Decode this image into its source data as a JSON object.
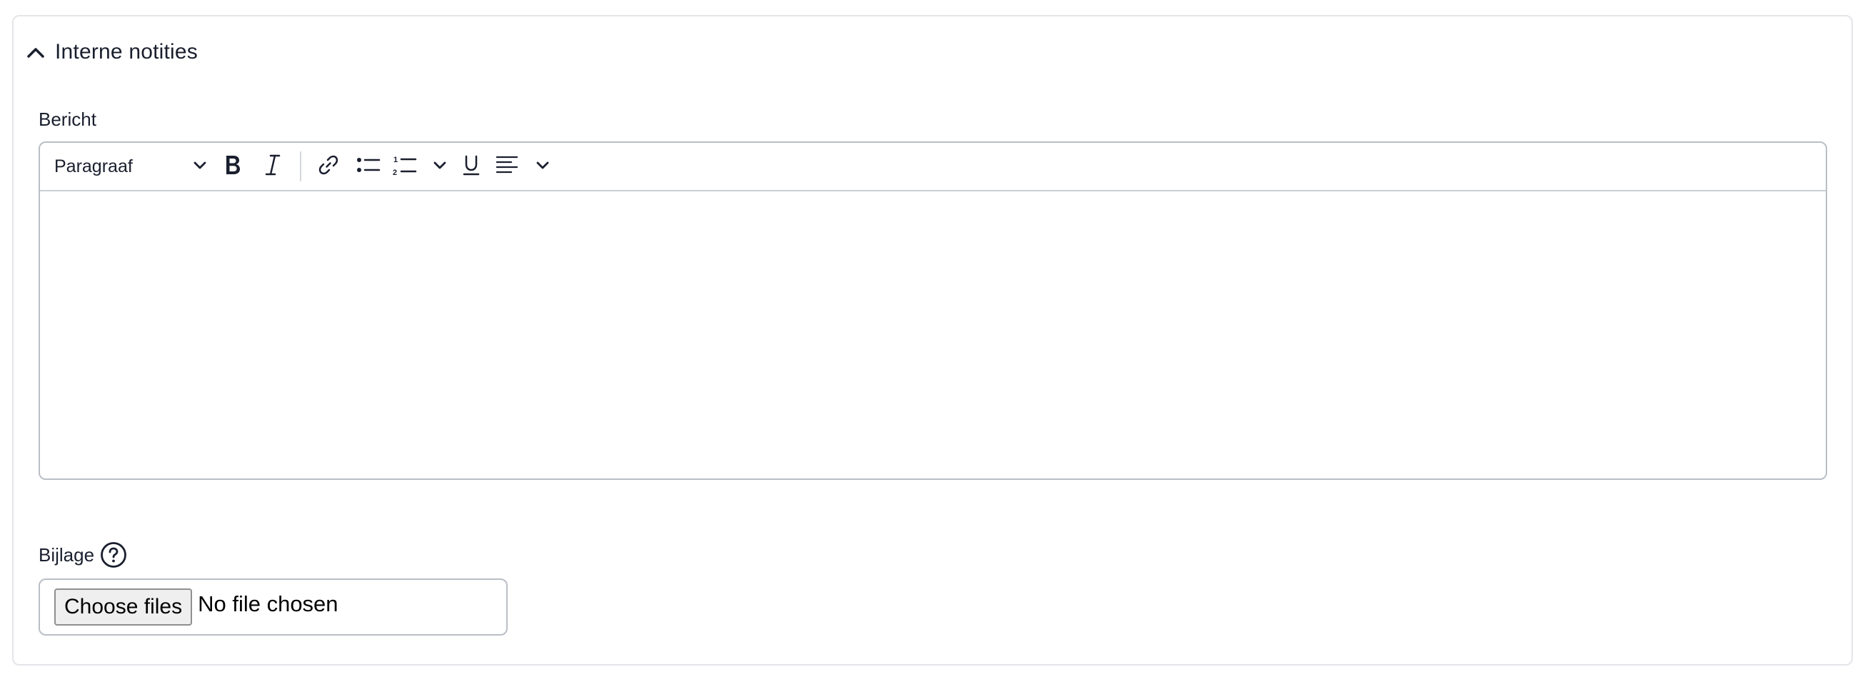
{
  "section": {
    "title": "Interne notities",
    "expanded": true
  },
  "message": {
    "label": "Bericht",
    "toolbar": {
      "paragraph_style": "Paragraaf",
      "buttons": [
        "bold",
        "italic",
        "link",
        "bulleted-list",
        "numbered-list",
        "underline",
        "align-left"
      ]
    },
    "content": ""
  },
  "attachment": {
    "label": "Bijlage",
    "choose_button": "Choose files",
    "status": "No file chosen"
  },
  "colors": {
    "text": "#1a1f2e",
    "border": "#b9bec6",
    "panel_border": "#e3e5e8"
  }
}
